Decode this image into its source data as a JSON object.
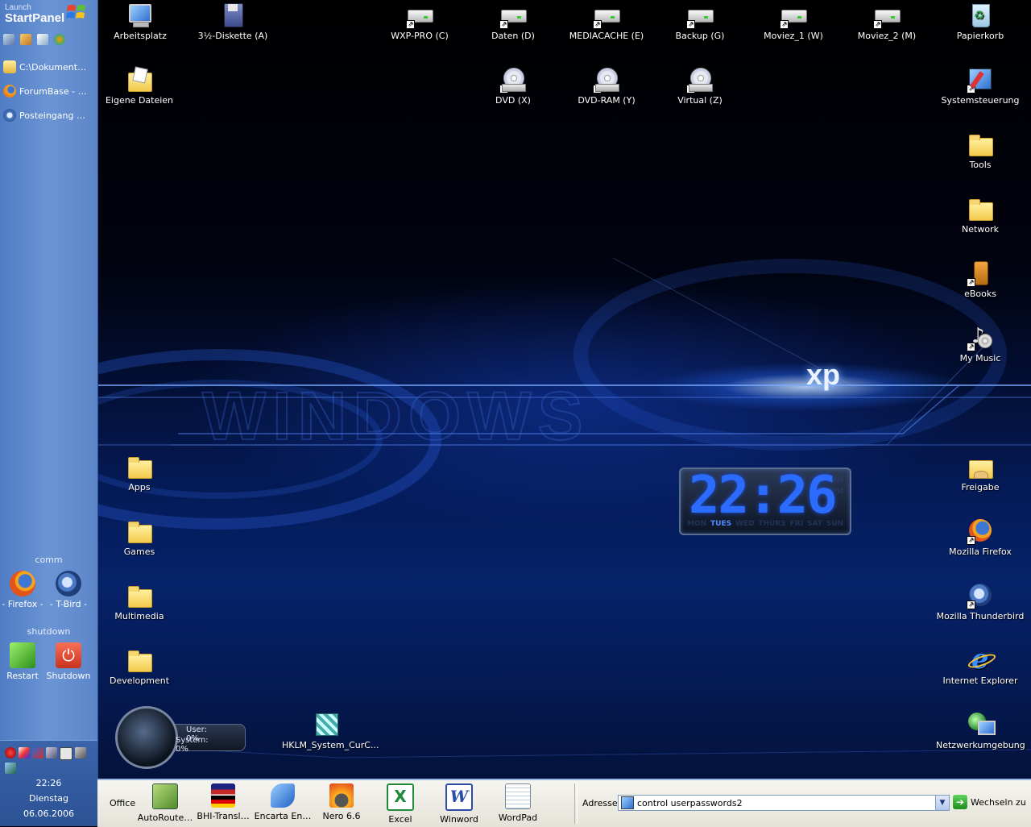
{
  "start_panel": {
    "logo_line1": "Launch",
    "logo_line2": "StartPanel",
    "tasks": [
      {
        "label": "C:\\Dokument…",
        "icon": "folder-icon"
      },
      {
        "label": "ForumBase - …",
        "icon": "firefox-icon"
      },
      {
        "label": "Posteingang …",
        "icon": "thunderbird-icon"
      }
    ],
    "comm_label": "comm",
    "comm_items": [
      {
        "label": "- Firefox -",
        "icon": "firefox-icon"
      },
      {
        "label": "- T-Bird -",
        "icon": "thunderbird-icon"
      }
    ],
    "shutdown_label": "shutdown",
    "shutdown_items": [
      {
        "label": "Restart",
        "icon": "restart-icon"
      },
      {
        "label": "Shutdown",
        "icon": "power-icon"
      }
    ],
    "clock": {
      "time": "22:26",
      "day": "Dienstag",
      "date": "06.06.2006"
    }
  },
  "desktop": {
    "wallpaper_text": "xp",
    "icons_top": [
      {
        "label": "Arbeitsplatz",
        "icon": "my-computer-icon"
      },
      {
        "label": "3½-Diskette (A)",
        "icon": "floppy-icon"
      },
      {
        "label": "WXP-PRO (C)",
        "icon": "hard-drive-icon"
      },
      {
        "label": "Daten (D)",
        "icon": "hard-drive-icon"
      },
      {
        "label": "MEDIACACHE (E)",
        "icon": "hard-drive-icon"
      },
      {
        "label": "Backup (G)",
        "icon": "hard-drive-icon"
      },
      {
        "label": "Moviez_1 (W)",
        "icon": "hard-drive-icon"
      },
      {
        "label": "Moviez_2 (M)",
        "icon": "hard-drive-icon"
      },
      {
        "label": "Papierkorb",
        "icon": "recycle-bin-icon"
      }
    ],
    "icons_row2": [
      {
        "label": "Eigene Dateien",
        "icon": "my-documents-icon"
      },
      {
        "label": "DVD (X)",
        "icon": "cd-drive-icon"
      },
      {
        "label": "DVD-RAM (Y)",
        "icon": "cd-drive-icon"
      },
      {
        "label": "Virtual (Z)",
        "icon": "cd-drive-icon"
      }
    ],
    "icons_right": [
      {
        "label": "Systemsteuerung",
        "icon": "control-panel-icon"
      },
      {
        "label": "Tools",
        "icon": "folder-icon"
      },
      {
        "label": "Network",
        "icon": "folder-icon"
      },
      {
        "label": "eBooks",
        "icon": "ebook-icon"
      },
      {
        "label": "My Music",
        "icon": "music-icon"
      },
      {
        "label": "Freigabe",
        "icon": "shared-folder-icon"
      },
      {
        "label": "Mozilla Firefox",
        "icon": "firefox-icon"
      },
      {
        "label": "Mozilla Thunderbird",
        "icon": "thunderbird-icon"
      },
      {
        "label": "Internet Explorer",
        "icon": "internet-explorer-icon"
      },
      {
        "label": "Netzwerkumgebung",
        "icon": "network-places-icon"
      }
    ],
    "icons_left": [
      {
        "label": "Apps",
        "icon": "folder-icon"
      },
      {
        "label": "Games",
        "icon": "folder-icon"
      },
      {
        "label": "Multimedia",
        "icon": "folder-icon"
      },
      {
        "label": "Development",
        "icon": "folder-icon"
      }
    ],
    "reg_file": {
      "label": "HKLM_System_CurC...",
      "icon": "registry-file-icon"
    }
  },
  "clock_widget": {
    "time": "22:26",
    "am": "AM",
    "pm": "PM",
    "days": [
      "MON",
      "TUES",
      "WED",
      "THURS",
      "FRI",
      "SAT",
      "SUN"
    ],
    "active_day": "TUES"
  },
  "cpu_meter": {
    "user": "User: 0%",
    "system": "System: 0%"
  },
  "taskbar": {
    "group_label": "Office",
    "buttons": [
      {
        "label": "AutoRoute…",
        "icon": "autoroute-icon",
        "color": "#6fa84a"
      },
      {
        "label": "BHI-Transl…",
        "icon": "flags-icon",
        "color": "#c03030"
      },
      {
        "label": "Encarta En…",
        "icon": "encarta-icon",
        "color": "#3b7fd4"
      },
      {
        "label": "Nero 6.6",
        "icon": "nero-icon",
        "color": "#e05a12"
      },
      {
        "label": "Excel",
        "icon": "excel-icon",
        "color": "#1f8a3a"
      },
      {
        "label": "Winword",
        "icon": "word-icon",
        "color": "#2a4ea8"
      },
      {
        "label": "WordPad",
        "icon": "wordpad-icon",
        "color": "#5a9ad8"
      }
    ],
    "address_label": "Adresse",
    "address_value": "control userpasswords2",
    "go_label": "Wechseln zu"
  }
}
